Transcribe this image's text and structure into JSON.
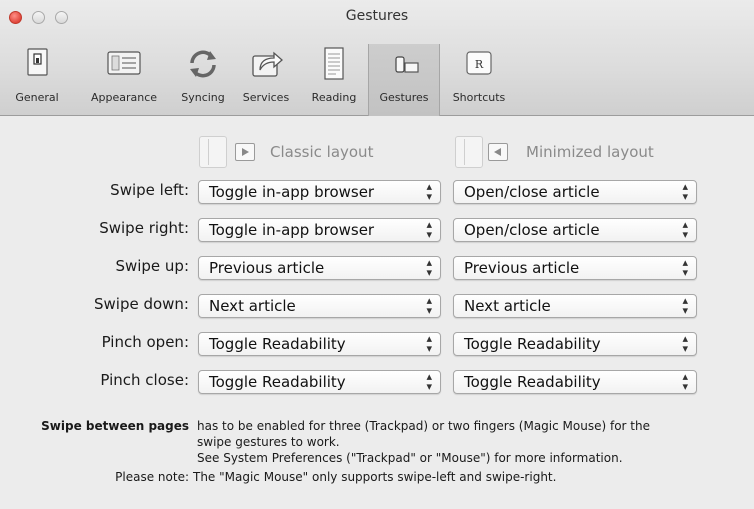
{
  "window": {
    "title": "Gestures"
  },
  "toolbar": {
    "items": [
      {
        "label": "General",
        "icon": "general-icon"
      },
      {
        "label": "Appearance",
        "icon": "appearance-icon"
      },
      {
        "label": "Syncing",
        "icon": "sync-icon"
      },
      {
        "label": "Services",
        "icon": "share-icon"
      },
      {
        "label": "Reading",
        "icon": "reading-icon"
      },
      {
        "label": "Gestures",
        "icon": "gestures-icon",
        "selected": true
      },
      {
        "label": "Shortcuts",
        "icon": "shortcuts-icon",
        "key": "R"
      }
    ]
  },
  "layouts": {
    "classic": "Classic layout",
    "minimized": "Minimized layout"
  },
  "gestures": [
    {
      "label": "Swipe left:",
      "classic": "Toggle in-app browser",
      "minimized": "Open/close article"
    },
    {
      "label": "Swipe right:",
      "classic": "Toggle in-app browser",
      "minimized": "Open/close article"
    },
    {
      "label": "Swipe up:",
      "classic": "Previous article",
      "minimized": "Previous article"
    },
    {
      "label": "Swipe down:",
      "classic": "Next article",
      "minimized": "Next article"
    },
    {
      "label": "Pinch open:",
      "classic": "Toggle Readability",
      "minimized": "Toggle Readability"
    },
    {
      "label": "Pinch close:",
      "classic": "Toggle Readability",
      "minimized": "Toggle Readability"
    }
  ],
  "notes": {
    "swipe_key": "Swipe between pages",
    "swipe_line1": "has to be enabled for three (Trackpad) or two fingers (Magic Mouse) for the",
    "swipe_line2": "swipe gestures to work.",
    "swipe_line3": "See System Preferences (\"Trackpad\" or \"Mouse\") for more information.",
    "note_key": "Please note:",
    "note_text": "The \"Magic Mouse\" only supports swipe-left and swipe-right."
  }
}
